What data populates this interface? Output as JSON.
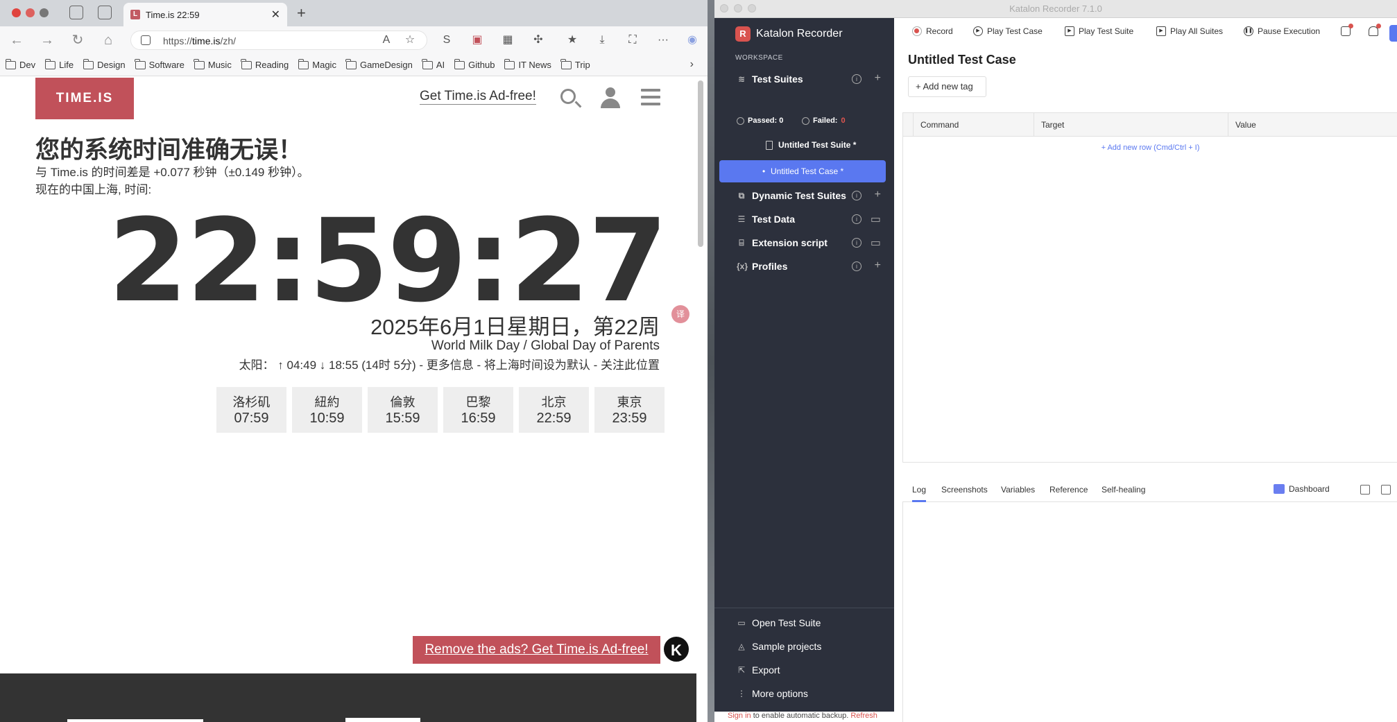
{
  "browser": {
    "tab_title": "Time.is 22:59",
    "url_prefix": "https://",
    "url_host": "time.is",
    "url_path": "/zh/",
    "bookmarks": [
      "Dev",
      "Life",
      "Design",
      "Software",
      "Music",
      "Reading",
      "Magic",
      "GameDesign",
      "AI",
      "Github",
      "IT News",
      "Trip"
    ]
  },
  "page": {
    "logo": "TIME.IS",
    "adfree_link": "Get Time.is Ad-free!",
    "headline": "您的系统时间准确无误！",
    "offset_line": "与 Time.is 的时间差是 +0.077 秒钟（±0.149 秒钟）。",
    "location_line": "现在的中国上海, 时间:",
    "clock": "22:59:27",
    "date": "2025年6月1日星期日，第22周",
    "event": "World Milk Day / Global Day of Parents",
    "sun": "太阳： ↑ 04:49 ↓ 18:55 (14时 5分) - 更多信息 - 将上海时间设为默认 - 关注此位置",
    "cities": [
      {
        "name": "洛杉矶",
        "time": "07:59"
      },
      {
        "name": "紐約",
        "time": "10:59"
      },
      {
        "name": "倫敦",
        "time": "15:59"
      },
      {
        "name": "巴黎",
        "time": "16:59"
      },
      {
        "name": "北京",
        "time": "22:59"
      },
      {
        "name": "東京",
        "time": "23:59"
      }
    ],
    "ad_banner": "Remove the ads? Get Time.is Ad-free!",
    "k_icon": "K"
  },
  "katalon": {
    "window_title": "Katalon Recorder 7.1.0",
    "brand": "Katalon Recorder",
    "brand_letter": "R",
    "workspace": "WORKSPACE",
    "sections": {
      "test_suites": "Test Suites",
      "dynamic": "Dynamic Test Suites",
      "test_data": "Test Data",
      "extension": "Extension script",
      "profiles": "Profiles"
    },
    "passed": "Passed: 0",
    "failed_label": "Failed: ",
    "failed_value": "0",
    "suite_item": "Untitled Test Suite *",
    "case_item": "Untitled Test Case *",
    "bottom": {
      "open": "Open Test Suite",
      "samples": "Sample projects",
      "export": "Export",
      "more": "More options"
    },
    "toolbar": {
      "record": "Record",
      "play_case": "Play Test Case",
      "play_suite": "Play Test Suite",
      "play_all": "Play All Suites",
      "pause": "Pause Execution"
    },
    "case_title": "Untitled Test Case",
    "add_tag": "+ Add new tag",
    "columns": [
      "Command",
      "Target",
      "Value"
    ],
    "add_row": "+ Add new row (Cmd/Ctrl + I)",
    "log_tabs": [
      "Log",
      "Screenshots",
      "Variables",
      "Reference",
      "Self-healing"
    ],
    "dashboard": "Dashboard",
    "status_sign_in": "Sign in",
    "status_mid": " to enable automatic backup. ",
    "status_refresh": "Refresh"
  }
}
